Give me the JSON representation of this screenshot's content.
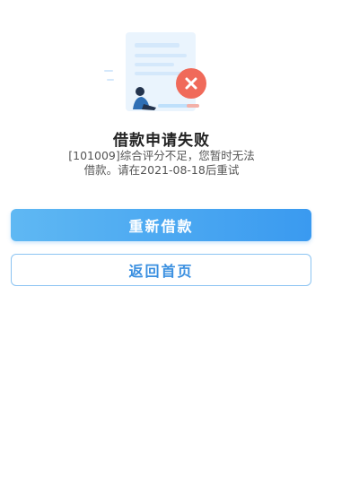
{
  "result": {
    "title": "借款申请失败",
    "message": "[101009]综合评分不足，您暂时无法借款。请在2021-08-18后重试"
  },
  "actions": {
    "retry_label": "重新借款",
    "home_label": "返回首页"
  },
  "colors": {
    "primary": "#3a9af0",
    "error": "#f06a5a"
  },
  "icons": {
    "illustration": "loan-failed-illustration",
    "error_badge": "close-icon"
  }
}
